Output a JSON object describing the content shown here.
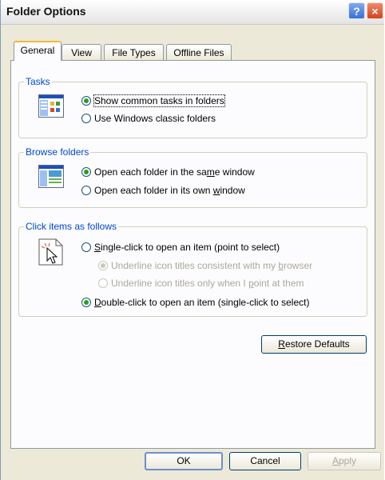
{
  "window": {
    "title": "Folder Options",
    "help_glyph": "?",
    "close_glyph": "×"
  },
  "tabs": [
    {
      "label": "General",
      "active": true
    },
    {
      "label": "View",
      "active": false
    },
    {
      "label": "File Types",
      "active": false
    },
    {
      "label": "Offline Files",
      "active": false
    }
  ],
  "tasks": {
    "title": "Tasks",
    "icon": "tasks-view-icon",
    "options": [
      {
        "label": "Show common tasks in folders",
        "checked": true
      },
      {
        "label": "Use Windows classic folders",
        "checked": false
      }
    ]
  },
  "browse": {
    "title": "Browse folders",
    "icon": "browse-window-icon",
    "options": [
      {
        "label_pre": "Open each folder in the sa",
        "label_u": "m",
        "label_post": "e window",
        "checked": true
      },
      {
        "label_pre": "Open each folder in its own ",
        "label_u": "w",
        "label_post": "indow",
        "checked": false
      }
    ]
  },
  "click": {
    "title": "Click items as follows",
    "icon": "pointer-click-icon",
    "single": {
      "label_u": "S",
      "label_post": "ingle-click to open an item (point to select)",
      "checked": false
    },
    "sub_options": [
      {
        "label_pre": "Underline icon titles consistent with my ",
        "label_u": "b",
        "label_post": "rowser",
        "checked": true
      },
      {
        "label_pre": "Underline icon titles only when I ",
        "label_u": "p",
        "label_post": "oint at them",
        "checked": false
      }
    ],
    "double": {
      "label_u": "D",
      "label_post": "ouble-click to open an item (single-click to select)",
      "checked": true
    }
  },
  "restore_button": {
    "label_u": "R",
    "label_post": "estore Defaults"
  },
  "footer": {
    "ok": "OK",
    "cancel": "Cancel",
    "apply_u": "A",
    "apply_post": "pply"
  },
  "colors": {
    "group_title": "#0046d5",
    "dialog_bg": "#ece9d8",
    "radio_check": "#21a121"
  }
}
